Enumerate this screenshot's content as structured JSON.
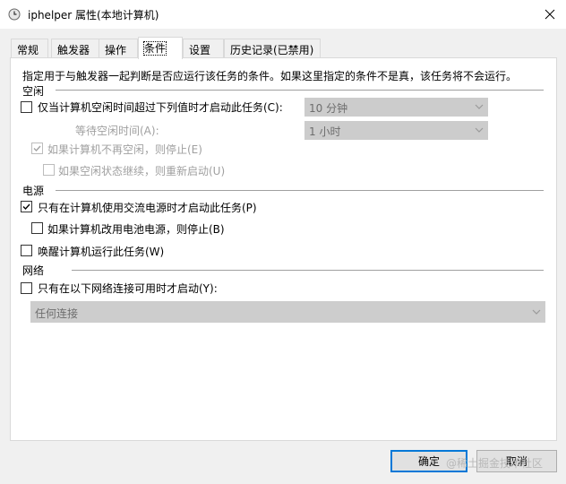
{
  "window": {
    "title": "iphelper 属性(本地计算机)",
    "icon": "clock-icon"
  },
  "tabs": [
    {
      "label": "常规",
      "active": false
    },
    {
      "label": "触发器",
      "active": false
    },
    {
      "label": "操作",
      "active": false
    },
    {
      "label": "条件",
      "active": true
    },
    {
      "label": "设置",
      "active": false
    },
    {
      "label": "历史记录(已禁用)",
      "active": false
    }
  ],
  "description": "指定用于与触发器一起判断是否应运行该任务的条件。如果这里指定的条件不是真，该任务将不会运行。",
  "idle": {
    "header": "空闲",
    "start_label": "仅当计算机空闲时间超过下列值时才启动此任务(C):",
    "start_checked": false,
    "idle_time_value": "10 分钟",
    "wait_label": "等待空闲时间(A):",
    "wait_value": "1 小时",
    "stop_label": "如果计算机不再空闲，则停止(E)",
    "stop_checked": true,
    "restart_label": "如果空闲状态继续，则重新启动(U)",
    "restart_checked": false
  },
  "power": {
    "header": "电源",
    "ac_label": "只有在计算机使用交流电源时才启动此任务(P)",
    "ac_checked": true,
    "battery_label": "如果计算机改用电池电源，则停止(B)",
    "battery_checked": false,
    "wake_label": "唤醒计算机运行此任务(W)",
    "wake_checked": false
  },
  "network": {
    "header": "网络",
    "start_label": "只有在以下网络连接可用时才启动(Y):",
    "start_checked": false,
    "connection_value": "任何连接"
  },
  "buttons": {
    "ok": "确定",
    "cancel": "取消"
  },
  "watermark": "@稀土掘金技术社区",
  "colors": {
    "accent": "#0078d7",
    "disabled_text": "#a0a0a0",
    "combo_disabled": "#cccccc"
  }
}
